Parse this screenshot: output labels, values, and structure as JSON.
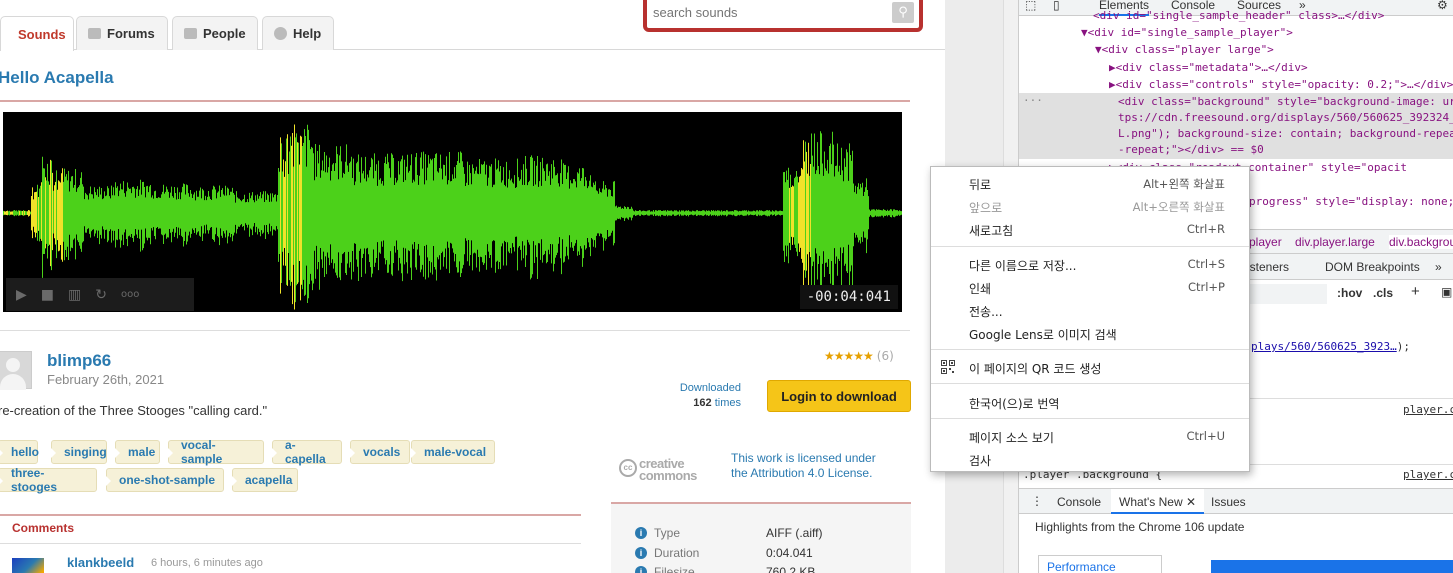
{
  "nav": {
    "tabs": [
      {
        "label": "Sounds",
        "active": true
      },
      {
        "label": "Forums"
      },
      {
        "label": "People"
      },
      {
        "label": "Help"
      }
    ],
    "search_placeholder": "search sounds"
  },
  "sound": {
    "title": "Hello Acapella",
    "timer": "-00:04:041",
    "author": "blimp66",
    "date": "February 26th, 2021",
    "rating_stars": "★★★★★",
    "rating_count": "(6)",
    "description": "re-creation of the Three Stooges \"calling card.\"",
    "downloaded_label": "Downloaded",
    "download_count": "162",
    "download_suffix": "times",
    "login_button": "Login to download",
    "tags": [
      "hello",
      "singing",
      "male",
      "vocal-sample",
      "a-capella",
      "vocals",
      "male-vocal",
      "three-stooges",
      "one-shot-sample",
      "acapella"
    ],
    "license_logo_line1": "creative",
    "license_logo_line2": "commons",
    "license_text": "This work is licensed under the Attribution 4.0 License.",
    "info": [
      {
        "key": "Type",
        "value": "AIFF (.aiff)"
      },
      {
        "key": "Duration",
        "value": "0:04.041"
      },
      {
        "key": "Filesize",
        "value": "760.2 KB"
      }
    ]
  },
  "comments": {
    "heading": "Comments",
    "first_user": "klankbeeld",
    "first_time": "6 hours, 6 minutes ago"
  },
  "devtools": {
    "tabs": [
      "Elements",
      "Console",
      "Sources",
      "»"
    ],
    "dom_lines": [
      {
        "pre": "<div id=\"single_sample_header\" class>…</div>"
      },
      {
        "pre": "▼<div id=\"single_sample_player\">"
      },
      {
        "pre": "▼<div class=\"player large\">"
      },
      {
        "pre": "▶<div class=\"metadata\">…</div>"
      },
      {
        "pre": "▶<div class=\"controls\" style=\"opacity: 0.2;\">…</div>"
      },
      {
        "pre": "<div class=\"background\" style=\"background-image: ur"
      },
      {
        "pre": "tps://cdn.freesound.org/displays/560/560625_392324_"
      },
      {
        "pre": "L.png\"); background-size: contain; background-repea"
      },
      {
        "pre": "-repeat;\"></div> == $0"
      },
      {
        "pre": "▶<div class=\"readout-container\" style=\"opacit"
      },
      {
        "pre": "progress\" style=\"display: none;"
      }
    ],
    "breadcrumb_1": "player",
    "breadcrumb_2": "div.player.large",
    "breadcrumb_3": "div.backgrou",
    "subtabs": [
      "isteners",
      "DOM Breakpoints",
      "»"
    ],
    "hov": ":hov",
    "cls": ".cls",
    "style_link": "plays/560/560625_3923…",
    "style_link_tail": ");",
    "rule_source_1": "player.c",
    "rule_selector_2": ".player .background {",
    "rule_source_2": "player.c",
    "drawer_tabs": [
      "Console",
      "What's New",
      "Issues"
    ],
    "whats_new": "Highlights from the Chrome 106 update",
    "perf_card": "Performance"
  },
  "context_menu": {
    "items": [
      {
        "label": "뒤로",
        "shortcut": "Alt+왼쪽 화살표",
        "disabled": false
      },
      {
        "label": "앞으로",
        "shortcut": "Alt+오른쪽 화살표",
        "disabled": true
      },
      {
        "label": "새로고침",
        "shortcut": "Ctrl+R",
        "disabled": false
      },
      {
        "label": "다른 이름으로 저장...",
        "shortcut": "Ctrl+S",
        "disabled": false
      },
      {
        "label": "인쇄",
        "shortcut": "Ctrl+P",
        "disabled": false
      },
      {
        "label": "전송...",
        "shortcut": "",
        "disabled": false
      },
      {
        "label": "Google Lens로 이미지 검색",
        "shortcut": "",
        "disabled": false
      },
      {
        "label": "이 페이지의 QR 코드 생성",
        "shortcut": "",
        "disabled": false
      },
      {
        "label": "한국어(으)로 번역",
        "shortcut": "",
        "disabled": false
      },
      {
        "label": "페이지 소스 보기",
        "shortcut": "Ctrl+U",
        "disabled": false
      },
      {
        "label": "검사",
        "shortcut": "",
        "disabled": false
      }
    ]
  },
  "colors": {
    "link": "#2a7ab0",
    "brand_red": "#b8312f",
    "wave_green": "#4cd11a",
    "wave_yellow": "#f0e22a",
    "login_yellow": "#f5c518"
  }
}
